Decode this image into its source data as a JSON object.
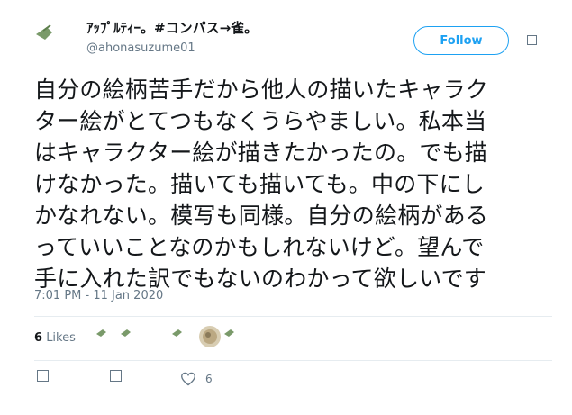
{
  "user": {
    "display_name": "ｱｯﾌﾟﾙﾃｨｰ。#コンパス→雀。",
    "handle": "@ahonasuzume01"
  },
  "follow_label": "Follow",
  "tweet": {
    "lines": [
      "自分の絵柄苦手だから他人の描いたキャラク",
      "ター絵がとてつもなくうらやましい。私本当",
      "はキャラクター絵が描きたかったの。でも描",
      "けなかった。描いても描いても。中の下にし",
      "かなれない。模写も同様。自分の絵柄がある",
      "っていいことなのかもしれないけど。望んで",
      "手に入れた訳でもないのわかって欲しいです"
    ],
    "timestamp": "7:01 PM - 11 Jan 2020"
  },
  "likes": {
    "count": "6",
    "label": "Likes"
  },
  "actions": {
    "like_count": "6"
  }
}
